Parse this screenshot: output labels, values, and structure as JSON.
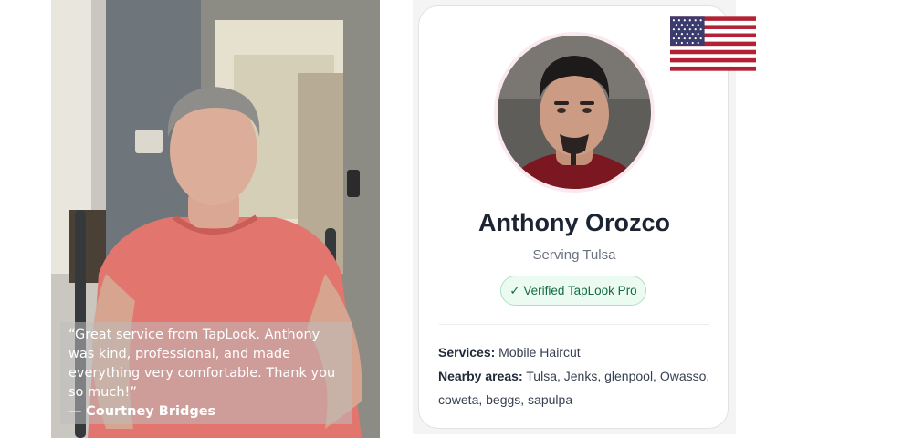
{
  "testimonial": {
    "quote": "“Great service from TapLook. Anthony was kind, professional, and made everything very comfortable. Thank you so much!”",
    "author_prefix": "— ",
    "author": "Courtney Bridges"
  },
  "profile": {
    "name": "Anthony Orozco",
    "serving": "Serving Tulsa",
    "badge": "✓ Verified TapLook Pro",
    "services_label": "Services:",
    "services_value": "Mobile Haircut",
    "nearby_label": "Nearby areas:",
    "nearby_value": "Tulsa, Jenks, glenpool, Owasso, coweta, beggs, sapulpa"
  },
  "colors": {
    "badge_bg": "#ecfbf2",
    "badge_border": "#a7e3c2",
    "badge_text": "#146c43",
    "flag_red": "#b22234",
    "flag_blue": "#3c3b6e"
  },
  "icons": {
    "flag": "us-flag-icon",
    "verified": "check-icon"
  }
}
